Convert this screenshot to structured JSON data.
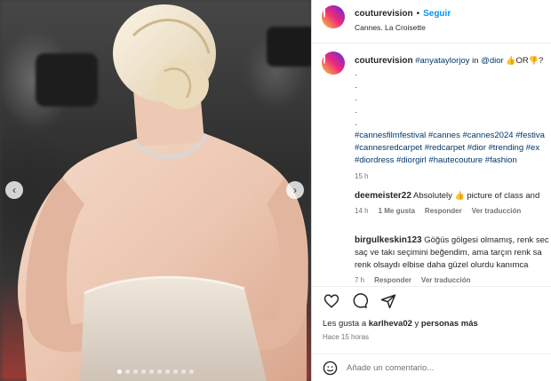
{
  "post": {
    "slide_count": 10,
    "active_slide": 1
  },
  "header": {
    "username": "couturevision",
    "separator": "•",
    "follow_label": "Seguir",
    "location": "Cannes. La Croisette"
  },
  "caption": {
    "username": "couturevision",
    "mention_1": "#anyataylorjoy",
    "in_word": " in ",
    "mention_2": "@dior",
    "emoji_1": "👍",
    "or_word": "OR",
    "emoji_2": "👎",
    "question": "?",
    "dots": [
      ".",
      ".",
      ".",
      ".",
      "."
    ],
    "hashtags_line_1": "#cannesfilmfestival #cannes #cannes2024 #festiva",
    "hashtags_line_2": "#cannesredcarpet #redcarpet #dior #trending #ex",
    "hashtags_line_3": "#diordress #diorgirl #hautecouture #fashion",
    "time": "15 h"
  },
  "comments": [
    {
      "username": "deemeister22",
      "text": " Absolutely ",
      "emoji": "👍",
      "text_after": " picture of class and",
      "time": "14 h",
      "likes": "1 Me gusta",
      "reply": "Responder",
      "translate": "Ver traducción"
    },
    {
      "username": "birgulkeskin123",
      "text_line_1": " Göğüs gölgesi olmamış, renk sec",
      "text_line_2": "saç ve takı seçimini beğendim, ama tarçın renk sa",
      "text_line_3": "renk olsaydı elbise daha güzel olurdu kanımca",
      "time": "7 h",
      "reply": "Responder",
      "translate": "Ver traducción"
    }
  ],
  "actions": {
    "likes_prefix": "Les gusta a ",
    "liker": "karlheva02",
    "likes_mid": " y ",
    "likes_others": "personas más",
    "timestamp": "Hace 15 horas"
  },
  "add_comment": {
    "placeholder": "Añade un comentario..."
  },
  "colors": {
    "link": "#00376b",
    "follow": "#0095f6",
    "muted": "#737373"
  }
}
